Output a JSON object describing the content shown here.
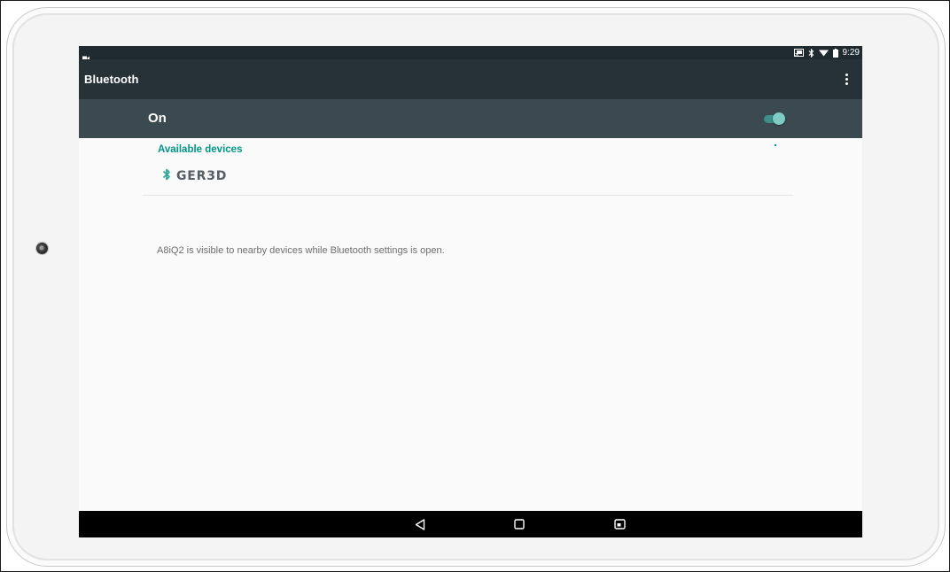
{
  "status_bar": {
    "time": "9:29",
    "left_icon": "video-camera-icon",
    "icons": [
      "cast-icon",
      "bluetooth-icon",
      "wifi-icon",
      "battery-icon"
    ]
  },
  "app_bar": {
    "title": "Bluetooth",
    "menu_icon": "more-vertical-icon"
  },
  "switch_bar": {
    "label": "On",
    "toggle_on": true,
    "accent_color": "#80cbc4"
  },
  "available_devices": {
    "header": "Available devices",
    "devices": [
      {
        "name": "GER3D",
        "icon": "bluetooth-icon"
      }
    ]
  },
  "visibility_message": "A8iQ2 is visible to nearby devices while Bluetooth settings is open.",
  "nav_bar": {
    "buttons": [
      "back-icon",
      "home-icon",
      "recents-icon"
    ]
  },
  "colors": {
    "status_bar": "#1f2b31",
    "app_bar": "#263238",
    "switch_bar": "#3b4a51",
    "accent": "#009688",
    "background": "#fafafa",
    "nav_bar": "#000000"
  }
}
